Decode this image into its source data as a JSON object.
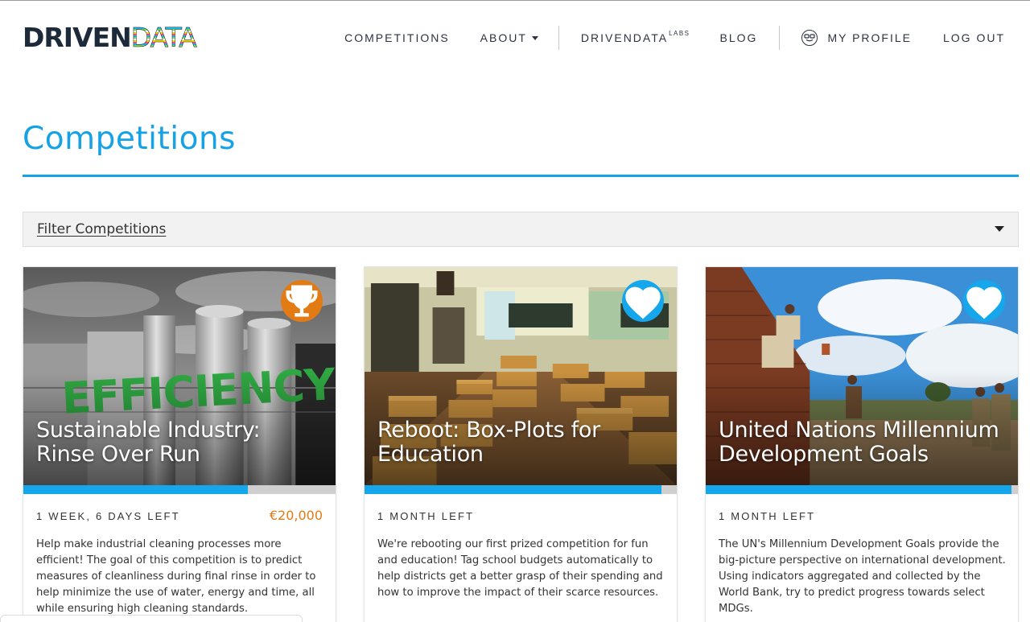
{
  "header": {
    "logo_part1": "DRIVEN",
    "logo_part2": "DATA",
    "nav": {
      "competitions": "COMPETITIONS",
      "about": "ABOUT",
      "labs_main": "DRIVENDATA",
      "labs_sup": "LABS",
      "blog": "BLOG",
      "my_profile": "MY PROFILE",
      "log_out": "LOG OUT"
    }
  },
  "page": {
    "title": "Competitions",
    "filter_label": "Filter Competitions"
  },
  "colors": {
    "accent": "#17a2e6",
    "prize": "#e27b14",
    "progress_track": "#cfcfcf",
    "text": "#333333"
  },
  "cards": [
    {
      "title": "Sustainable Industry: Rinse Over Run",
      "badge_icon": "trophy-icon",
      "hero_text": "EFFICIENCY",
      "progress": 0.72,
      "time_left": "1 WEEK, 6 DAYS LEFT",
      "prize": "€20,000",
      "description": "Help make industrial cleaning processes more efficient! The goal of this competition is to predict measures of cleanliness during final rinse in order to help minimize the use of water, energy and time, all while ensuring high cleaning standards."
    },
    {
      "title": "Reboot: Box-Plots for Education",
      "badge_icon": "heart-icon",
      "progress": 0.95,
      "time_left": "1 MONTH LEFT",
      "prize": "",
      "description": "We're rebooting our first prized competition for fun and education! Tag school budgets automatically to help districts get a better grasp of their spending and how to improve the impact of their scarce resources."
    },
    {
      "title": "United Nations Millennium Development Goals",
      "badge_icon": "heart-icon",
      "progress": 0.98,
      "time_left": "1 MONTH LEFT",
      "prize": "",
      "description": "The UN's Millennium Development Goals provide the big-picture perspective on international development. Using indicators aggregated and collected by the World Bank, try to predict progress towards select MDGs."
    }
  ]
}
